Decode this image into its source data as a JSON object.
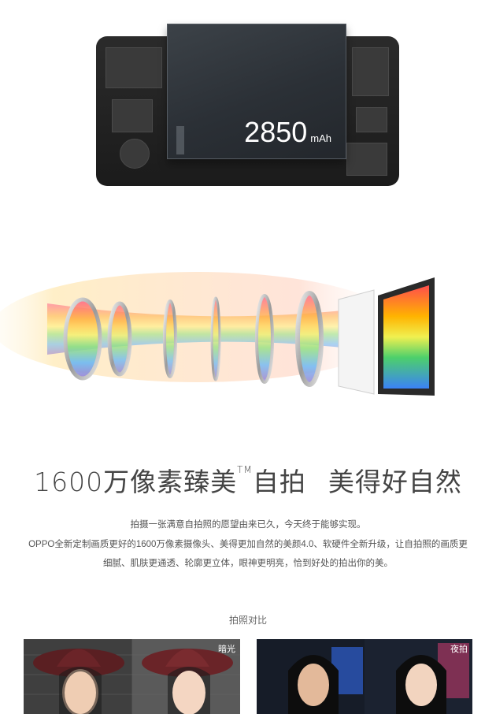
{
  "battery": {
    "capacity_number": "2850",
    "capacity_unit": "mAh"
  },
  "camera": {
    "headline_part1": "1600万像素臻美",
    "headline_tm": "TM",
    "headline_part2": "自拍",
    "headline_part3": "美得好自然",
    "paragraph_line1": "拍摄一张满意自拍照的愿望由来已久，今天终于能够实现。",
    "paragraph_line2": "OPPO全新定制画质更好的1600万像素摄像头、美得更加自然的美颜4.0、软硬件全新升级，让自拍照的画质更",
    "paragraph_line3": "细腻、肌肤更通透、轮廓更立体，眼神更明亮，恰到好处的拍出你的美。"
  },
  "comparison": {
    "title": "拍照对比",
    "left_tag": "暗光",
    "right_tag": "夜拍"
  }
}
